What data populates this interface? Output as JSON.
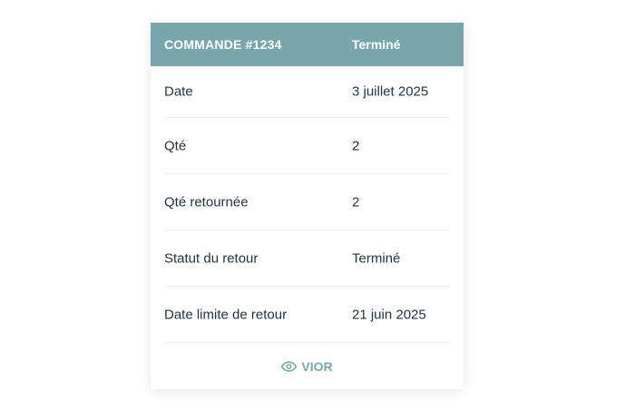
{
  "order": {
    "title": "COMMANDE #1234",
    "status": "Terminé"
  },
  "rows": [
    {
      "label": "Date",
      "value": "3 juillet 2025"
    },
    {
      "label": "Qté",
      "value": "2"
    },
    {
      "label": "Qté retournée",
      "value": "2"
    },
    {
      "label": "Statut du retour",
      "value": "Terminé"
    },
    {
      "label": "Date limite de retour",
      "value": "21 juin 2025"
    }
  ],
  "view_button": {
    "label": "VIOR",
    "icon": "eye-icon"
  },
  "colors": {
    "header_bg": "#78a6ab",
    "text": "#1f3242",
    "accent": "#78a6ab"
  }
}
